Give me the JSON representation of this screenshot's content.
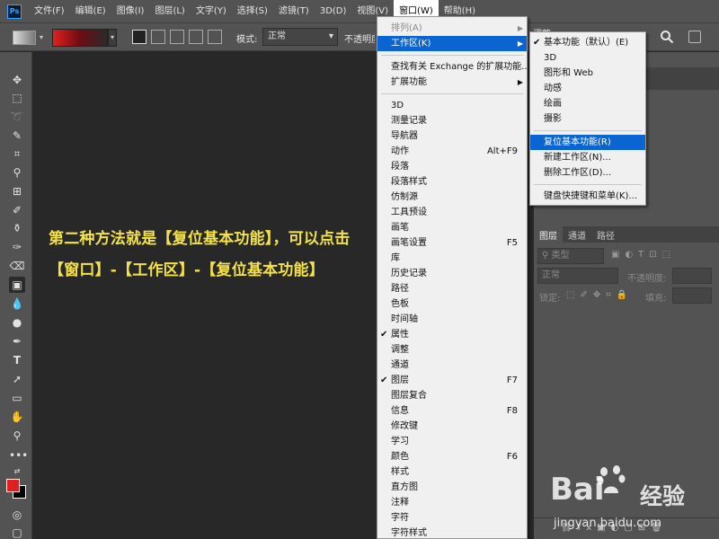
{
  "app": {
    "logo": "Ps"
  },
  "menubar": [
    {
      "label": "文件(F)"
    },
    {
      "label": "编辑(E)"
    },
    {
      "label": "图像(I)"
    },
    {
      "label": "图层(L)"
    },
    {
      "label": "文字(Y)"
    },
    {
      "label": "选择(S)"
    },
    {
      "label": "滤镜(T)"
    },
    {
      "label": "3D(D)"
    },
    {
      "label": "视图(V)"
    },
    {
      "label": "窗口(W)"
    },
    {
      "label": "帮助(H)"
    }
  ],
  "options": {
    "mode_label": "模式:",
    "mode_value": "正常",
    "opacity_label": "不透明度",
    "right_label": "调整"
  },
  "caption": {
    "line1": "第二种方法就是【复位基本功能】，可以点击",
    "line2": "【窗口】-【工作区】-【复位基本功能】"
  },
  "window_menu": {
    "items": [
      {
        "label": "排列(A)",
        "dim": true,
        "arrow": true
      },
      {
        "label": "工作区(K)",
        "highlighted": true,
        "arrow": true
      },
      {
        "separator": true
      },
      {
        "label": "查找有关 Exchange 的扩展功能..."
      },
      {
        "label": "扩展功能",
        "arrow": true
      },
      {
        "separator": true
      },
      {
        "label": "3D"
      },
      {
        "label": "测量记录"
      },
      {
        "label": "导航器"
      },
      {
        "label": "动作",
        "shortcut": "Alt+F9"
      },
      {
        "label": "段落"
      },
      {
        "label": "段落样式"
      },
      {
        "label": "仿制源"
      },
      {
        "label": "工具预设"
      },
      {
        "label": "画笔"
      },
      {
        "label": "画笔设置",
        "shortcut": "F5"
      },
      {
        "label": "库"
      },
      {
        "label": "历史记录"
      },
      {
        "label": "路径"
      },
      {
        "label": "色板"
      },
      {
        "label": "时间轴"
      },
      {
        "label": "属性",
        "checked": true
      },
      {
        "label": "调整"
      },
      {
        "label": "通道"
      },
      {
        "label": "图层",
        "checked": true,
        "shortcut": "F7"
      },
      {
        "label": "图层复合"
      },
      {
        "label": "信息",
        "shortcut": "F8"
      },
      {
        "label": "修改键"
      },
      {
        "label": "学习"
      },
      {
        "label": "颜色",
        "shortcut": "F6"
      },
      {
        "label": "样式"
      },
      {
        "label": "直方图"
      },
      {
        "label": "注释"
      },
      {
        "label": "字符"
      },
      {
        "label": "字符样式"
      }
    ]
  },
  "workspace_menu": {
    "items": [
      {
        "label": "基本功能（默认）(E)",
        "checked": true
      },
      {
        "label": "3D"
      },
      {
        "label": "图形和 Web"
      },
      {
        "label": "动感"
      },
      {
        "label": "绘画"
      },
      {
        "label": "摄影"
      },
      {
        "separator": true
      },
      {
        "label": "复位基本功能(R)",
        "highlighted": true
      },
      {
        "label": "新建工作区(N)..."
      },
      {
        "label": "删除工作区(D)..."
      },
      {
        "separator": true
      },
      {
        "label": "键盘快捷键和菜单(K)..."
      }
    ]
  },
  "layers_panel": {
    "tabs": [
      "图层",
      "通道",
      "路径"
    ],
    "filter_placeholder": "类型",
    "blend_mode": "正常",
    "opacity_label": "不透明度:",
    "lock_label": "锁定:",
    "fill_label": "填充:"
  },
  "watermark": {
    "brand": "Bai",
    "brand_suffix": "经验",
    "url": "jingyan.baidu.com"
  },
  "colors": {
    "foreground": "#e02020",
    "background": "#000000",
    "highlight": "#0a64d2",
    "caption": "#f4e24a"
  }
}
